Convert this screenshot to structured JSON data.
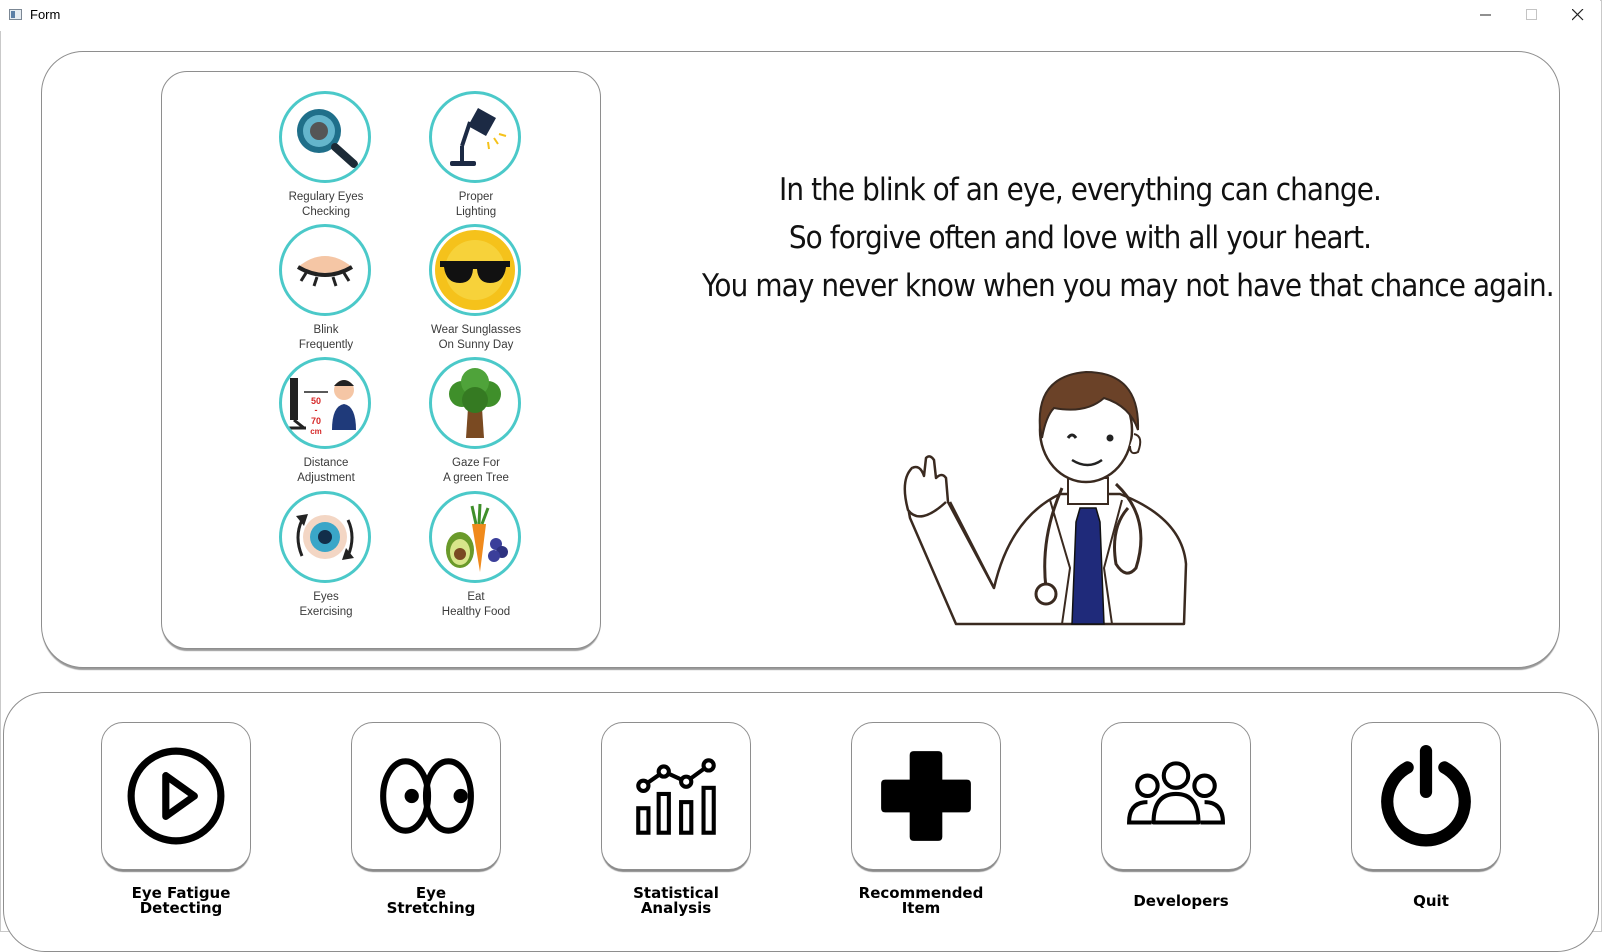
{
  "window": {
    "title": "Form"
  },
  "tips": [
    {
      "label": "Regulary Eyes\nChecking",
      "icon": "magnifier-icon"
    },
    {
      "label": "Proper\nLighting",
      "icon": "desk-lamp-icon"
    },
    {
      "label": "Blink\nFrequently",
      "icon": "closed-eye-icon"
    },
    {
      "label": "Wear Sunglasses\nOn Sunny Day",
      "icon": "sunglasses-icon"
    },
    {
      "label": "Distance\nAdjustment",
      "icon": "monitor-distance-icon",
      "distance_top": "50",
      "distance_dash": "-",
      "distance_bottom": "70",
      "distance_unit": "cm"
    },
    {
      "label": "Gaze For\nA green Tree",
      "icon": "tree-icon"
    },
    {
      "label": "Eyes\nExercising",
      "icon": "eye-rotate-icon"
    },
    {
      "label": "Eat\nHealthy Food",
      "icon": "vegetables-icon"
    }
  ],
  "quote": {
    "line1": "In the blink of an eye, everything can change.",
    "line2": "So forgive often and love with all your heart.",
    "line3": "You may never know when you may not have that chance again."
  },
  "nav": [
    {
      "label": "Eye Fatigue\nDetecting",
      "icon": "play-icon"
    },
    {
      "label": "Eye\nStretching",
      "icon": "eyes-icon"
    },
    {
      "label": "Statistical\nAnalysis",
      "icon": "chart-icon"
    },
    {
      "label": "Recommended\nItem",
      "icon": "plus-icon"
    },
    {
      "label": "Developers",
      "icon": "people-icon"
    },
    {
      "label": "Quit",
      "icon": "power-icon"
    }
  ],
  "colors": {
    "tip_ring": "#4bc9c9",
    "tie": "#1f2a7a",
    "sun": "#f5c21b"
  }
}
